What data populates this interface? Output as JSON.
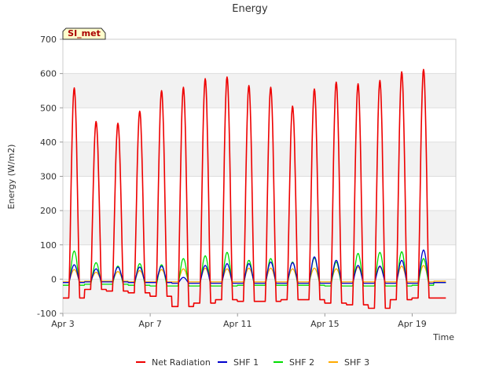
{
  "chart_data": {
    "type": "line",
    "title": "Energy",
    "xlabel": "Time",
    "ylabel": "Energy (W/m2)",
    "station_badge": "SI_met",
    "ylim": [
      -100,
      700
    ],
    "yticks": [
      -100,
      0,
      100,
      200,
      300,
      400,
      500,
      600,
      700
    ],
    "xlim": [
      "2021-04-03",
      "2021-04-21"
    ],
    "xticks": [
      {
        "date": "2021-04-03",
        "label": "Apr 3"
      },
      {
        "date": "2021-04-07",
        "label": "Apr 7"
      },
      {
        "date": "2021-04-11",
        "label": "Apr 11"
      },
      {
        "date": "2021-04-15",
        "label": "Apr 15"
      },
      {
        "date": "2021-04-19",
        "label": "Apr 19"
      }
    ],
    "grid": true,
    "legend_position": "bottom",
    "days": [
      "2021-04-03",
      "2021-04-04",
      "2021-04-05",
      "2021-04-06",
      "2021-04-07",
      "2021-04-08",
      "2021-04-09",
      "2021-04-10",
      "2021-04-11",
      "2021-04-12",
      "2021-04-13",
      "2021-04-14",
      "2021-04-15",
      "2021-04-16",
      "2021-04-17",
      "2021-04-18",
      "2021-04-19",
      "2021-04-20"
    ],
    "series": [
      {
        "name": "Net Radiation",
        "color": "#ee0000",
        "daily_peak": [
          558,
          460,
          455,
          490,
          550,
          560,
          585,
          590,
          565,
          560,
          505,
          555,
          575,
          570,
          580,
          605,
          612,
          0
        ],
        "night_value": [
          -55,
          -30,
          -35,
          -40,
          -50,
          -80,
          -70,
          -60,
          -65,
          -65,
          -60,
          -60,
          -70,
          -75,
          -85,
          -60,
          -55,
          -55
        ]
      },
      {
        "name": "SHF 1",
        "color": "#0000cc",
        "daily_peak": [
          42,
          30,
          35,
          35,
          38,
          5,
          40,
          45,
          45,
          50,
          48,
          65,
          55,
          40,
          38,
          55,
          85,
          0
        ],
        "night_value": [
          -10,
          -8,
          -8,
          -10,
          -10,
          -12,
          -12,
          -12,
          -12,
          -12,
          -12,
          -12,
          -12,
          -12,
          -12,
          -12,
          -12,
          -10
        ]
      },
      {
        "name": "SHF 2",
        "color": "#00dd00",
        "daily_peak": [
          82,
          48,
          38,
          45,
          42,
          60,
          68,
          78,
          55,
          60,
          50,
          62,
          50,
          75,
          78,
          80,
          60,
          0
        ],
        "night_value": [
          -18,
          -15,
          -15,
          -18,
          -20,
          -20,
          -20,
          -20,
          -18,
          -18,
          -18,
          -18,
          -20,
          -20,
          -20,
          -20,
          -18,
          -10
        ]
      },
      {
        "name": "SHF 3",
        "color": "#ffaa00",
        "daily_peak": [
          28,
          20,
          22,
          25,
          28,
          30,
          32,
          30,
          32,
          32,
          30,
          32,
          30,
          35,
          35,
          38,
          40,
          0
        ],
        "night_value": [
          -8,
          -6,
          -6,
          -8,
          -8,
          -8,
          -8,
          -8,
          -8,
          -8,
          -8,
          -8,
          -8,
          -8,
          -8,
          -8,
          -8,
          -6
        ]
      }
    ]
  }
}
